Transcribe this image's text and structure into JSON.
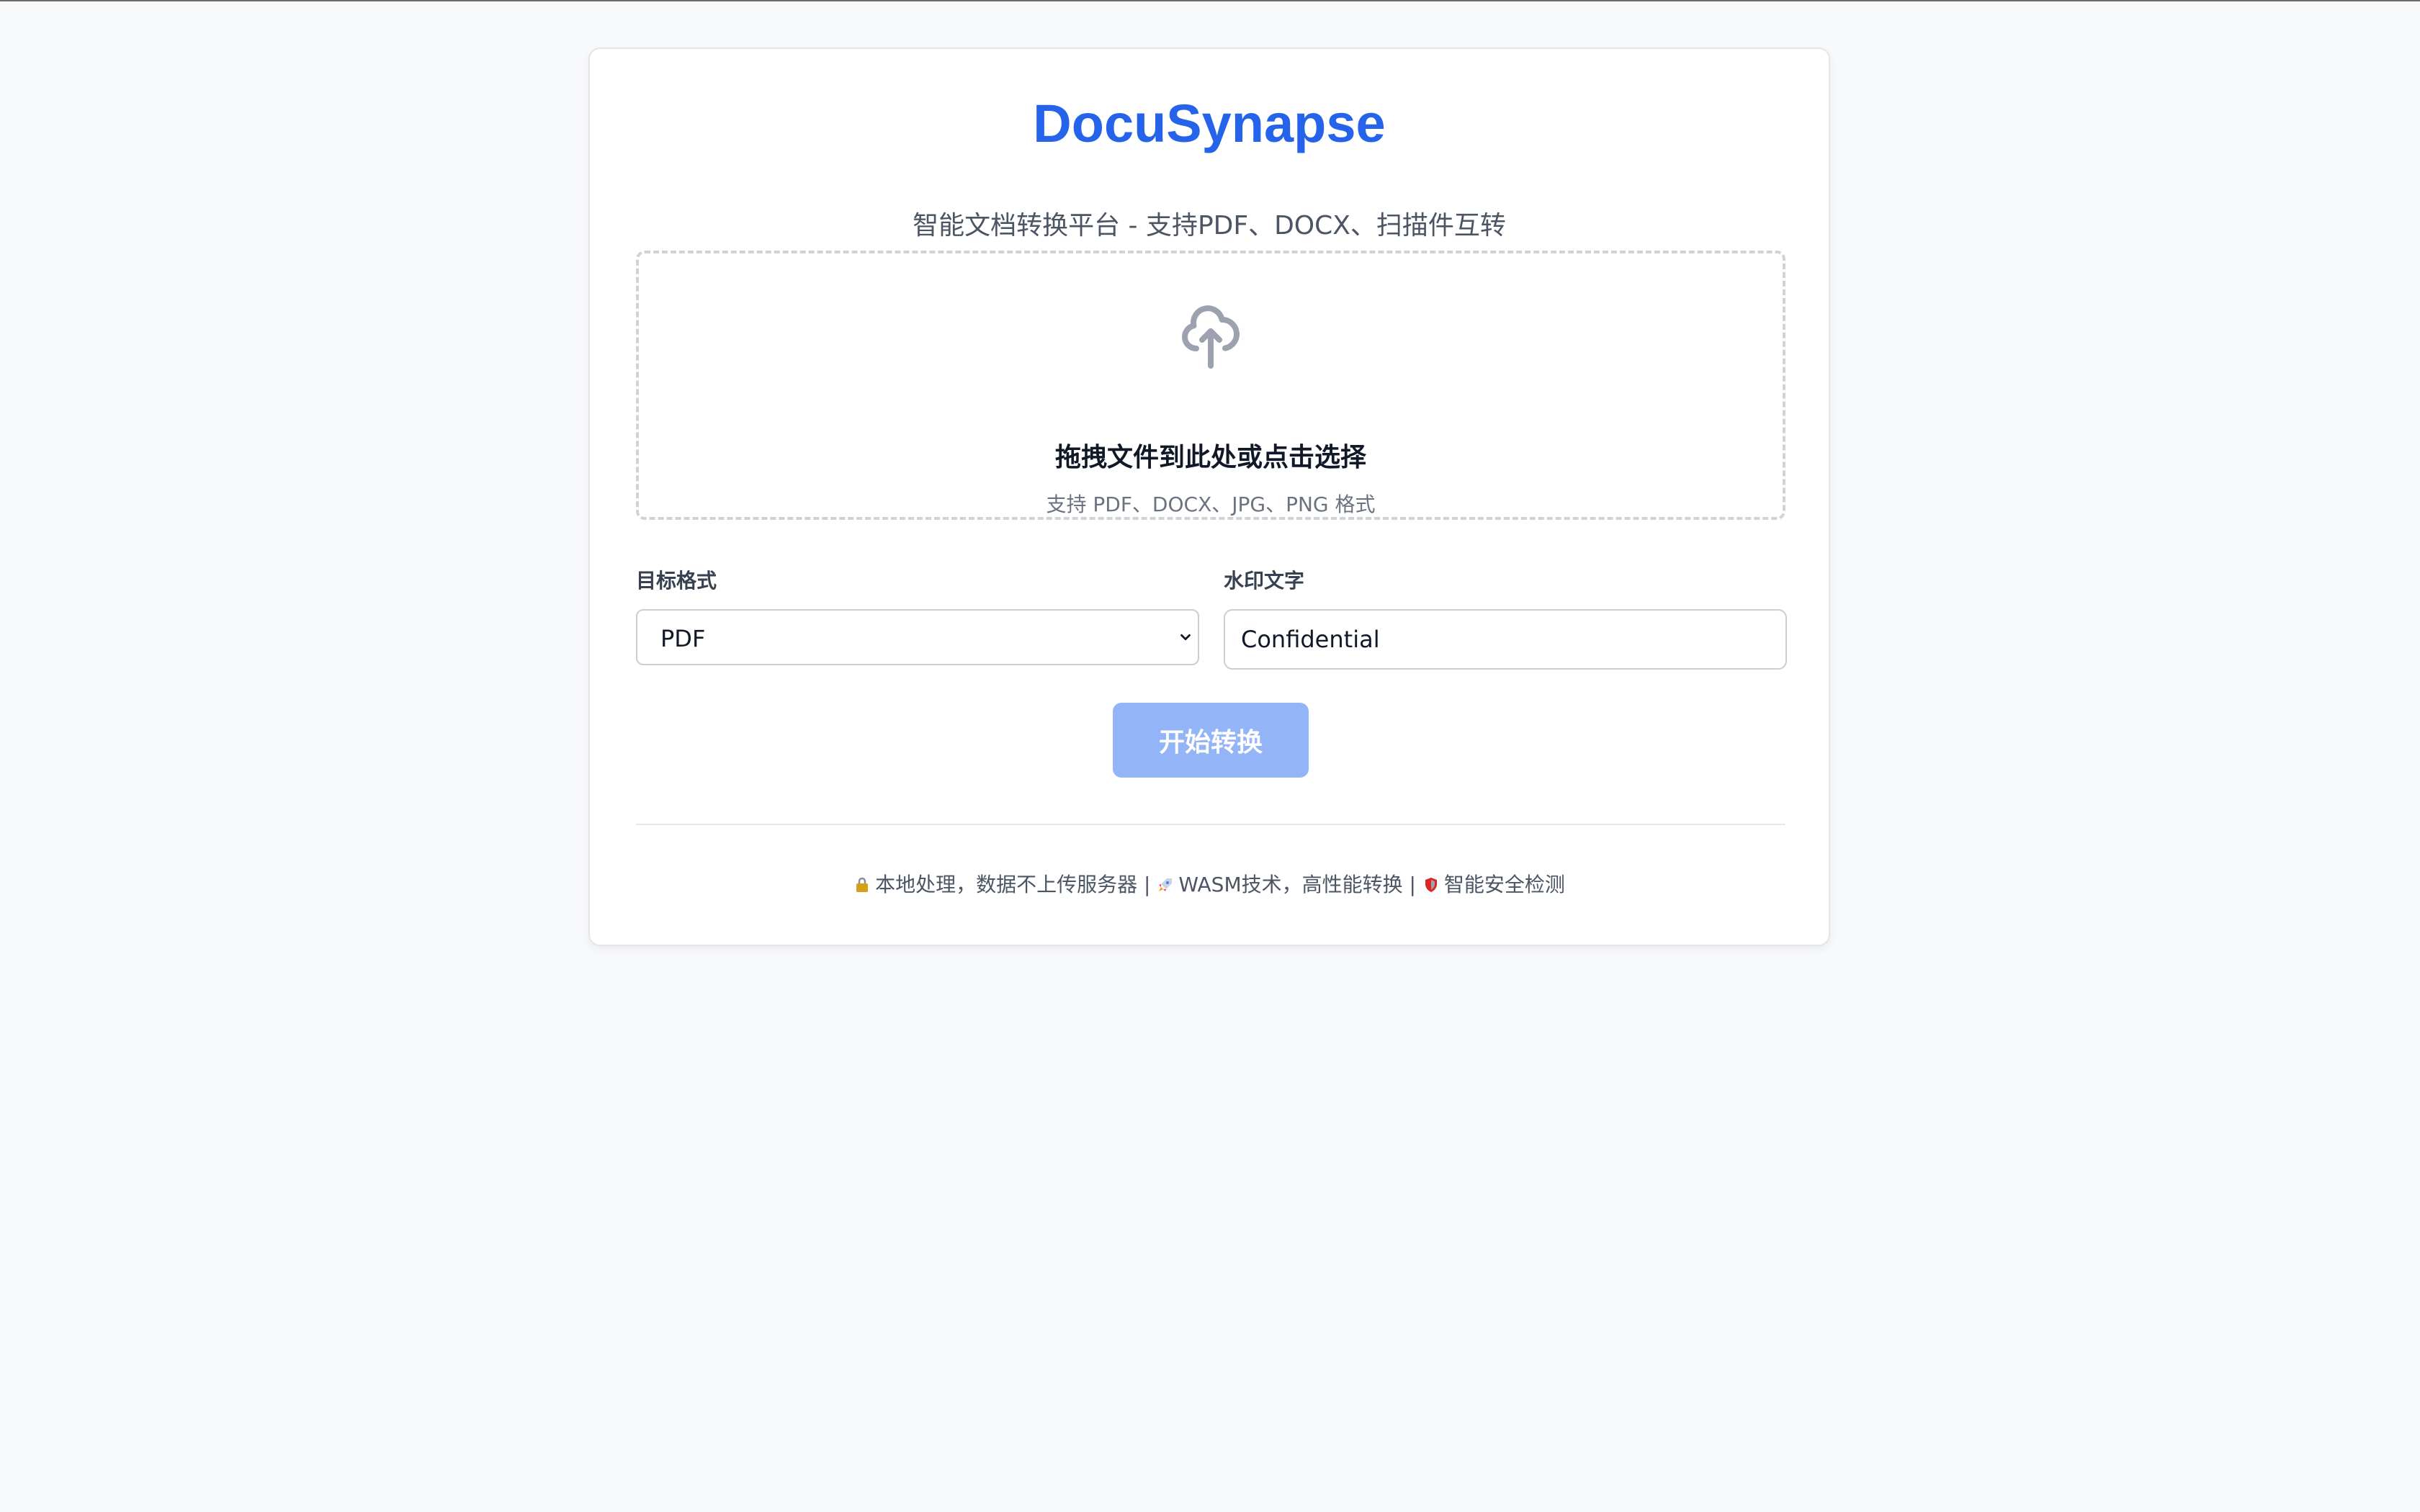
{
  "app": {
    "title": "DocuSynapse",
    "subtitle": "智能文档转换平台 - 支持PDF、DOCX、扫描件互转"
  },
  "upload": {
    "icon": "cloud-upload-icon",
    "title": "拖拽文件到此处或点击选择",
    "hint": "支持 PDF、DOCX、JPG、PNG 格式"
  },
  "form": {
    "target_format_label": "目标格式",
    "target_format_value": "PDF",
    "watermark_label": "水印文字",
    "watermark_value": "Confidential"
  },
  "actions": {
    "convert_label": "开始转换"
  },
  "footer": {
    "local_icon": "lock-icon",
    "local_text": "本地处理，数据不上传服务器",
    "separator": "|",
    "wasm_icon": "rocket-icon",
    "wasm_text": "WASM技术，高性能转换",
    "security_icon": "shield-icon",
    "security_text": "智能安全检测"
  },
  "colors": {
    "brand": "#2563eb",
    "button_disabled": "#93b4f7",
    "background": "#f8f9fb"
  }
}
